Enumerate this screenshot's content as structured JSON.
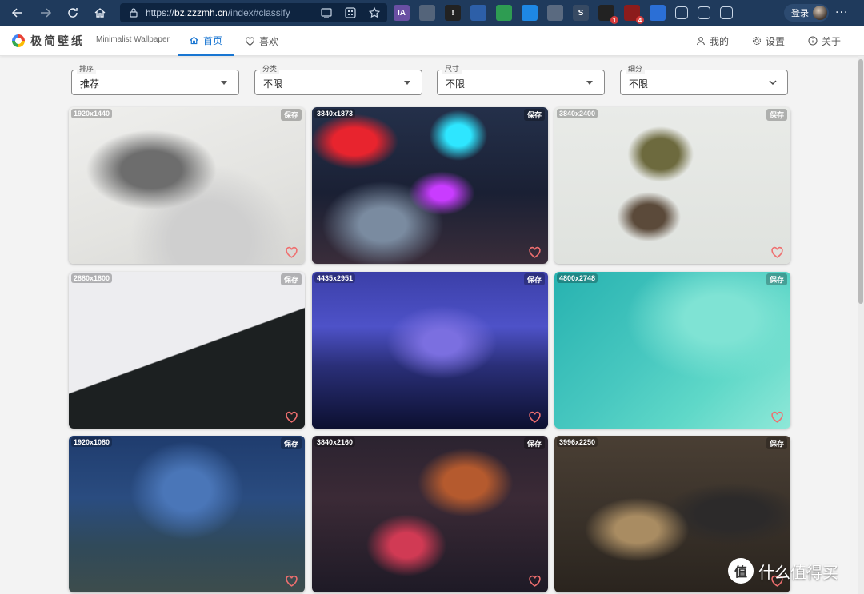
{
  "browser": {
    "url_prefix": "https://",
    "url_host": "bz.zzzmh.cn",
    "url_path": "/index#classify",
    "login_label": "登录",
    "extensions": [
      {
        "name": "ia-extension",
        "label": "IA",
        "color": "#6a4fa3"
      },
      {
        "name": "copy-extension",
        "label": "",
        "color": "#54647a"
      },
      {
        "name": "exclaim-extension",
        "label": "!",
        "color": "#222222"
      },
      {
        "name": "shield-extension",
        "label": "",
        "color": "#2d5fa8"
      },
      {
        "name": "green-extension",
        "label": "",
        "color": "#2e9c52"
      },
      {
        "name": "hex-extension",
        "label": "",
        "color": "#1e88e5"
      },
      {
        "name": "book-extension",
        "label": "",
        "color": "#5a6a80"
      },
      {
        "name": "s-extension",
        "label": "S",
        "color": "#374a63"
      },
      {
        "name": "dark-extension",
        "label": "",
        "color": "#222222",
        "badge": "1"
      },
      {
        "name": "ublock-extension",
        "label": "",
        "color": "#8c1c1c",
        "badge": "4"
      },
      {
        "name": "translate-extension",
        "label": "",
        "color": "#2b6fd6"
      },
      {
        "name": "puzzle-extension",
        "label": "",
        "color": "transparent"
      },
      {
        "name": "favorites-extension",
        "label": "",
        "color": "transparent"
      },
      {
        "name": "collections-extension",
        "label": "",
        "color": "transparent"
      }
    ]
  },
  "app": {
    "brand": "极简壁纸",
    "brand_en": "Minimalist Wallpaper",
    "tabs": [
      {
        "label": "首页",
        "icon": "home-icon",
        "active": true
      },
      {
        "label": "喜欢",
        "icon": "heart-icon",
        "active": false
      }
    ],
    "right_menu": [
      {
        "label": "我的",
        "icon": "person-icon"
      },
      {
        "label": "设置",
        "icon": "gear-icon"
      },
      {
        "label": "关于",
        "icon": "info-icon"
      }
    ]
  },
  "filters": [
    {
      "label": "排序",
      "value": "推荐"
    },
    {
      "label": "分类",
      "value": "不限"
    },
    {
      "label": "尺寸",
      "value": "不限"
    },
    {
      "label": "细分",
      "value": "不限"
    }
  ],
  "wallpapers": [
    {
      "resolution": "1920x1440",
      "save": "保存"
    },
    {
      "resolution": "3840x1873",
      "save": "保存"
    },
    {
      "resolution": "3840x2400",
      "save": "保存"
    },
    {
      "resolution": "2880x1800",
      "save": "保存"
    },
    {
      "resolution": "4435x2951",
      "save": "保存"
    },
    {
      "resolution": "4800x2748",
      "save": "保存"
    },
    {
      "resolution": "1920x1080",
      "save": "保存"
    },
    {
      "resolution": "3840x2160",
      "save": "保存"
    },
    {
      "resolution": "3996x2250",
      "save": "保存"
    }
  ],
  "watermark": {
    "text": "什么值得买",
    "badge": "值"
  }
}
